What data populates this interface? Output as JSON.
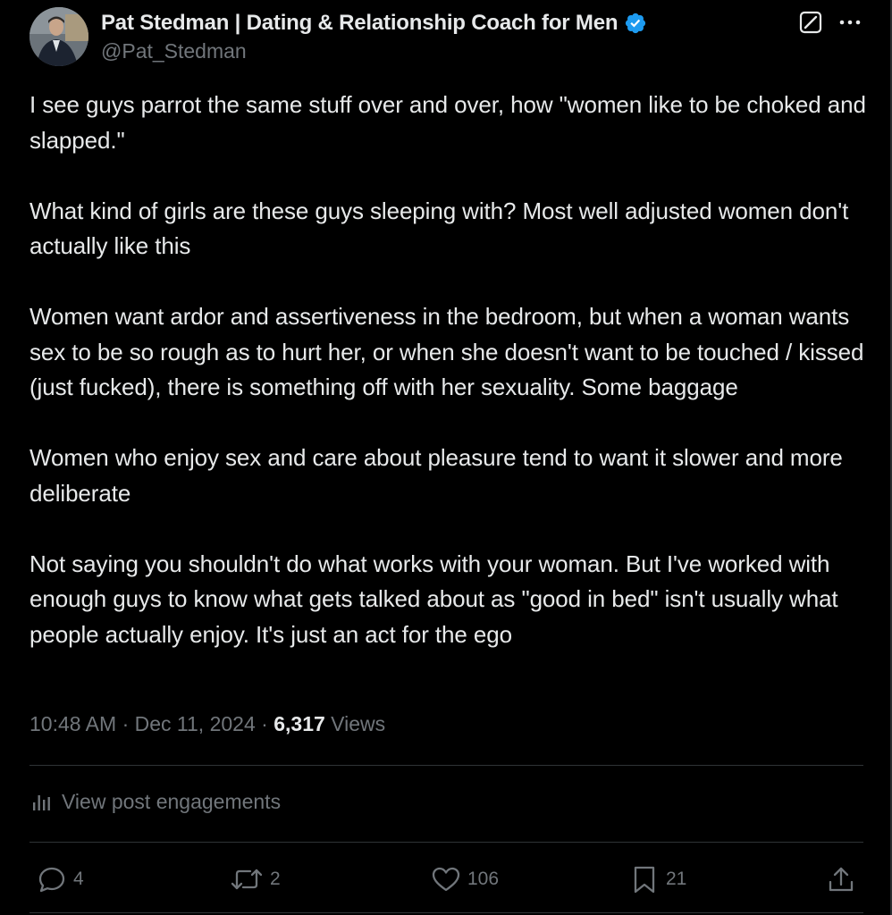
{
  "author": {
    "display_name": "Pat Stedman | Dating & Relationship Coach for Men",
    "handle": "@Pat_Stedman",
    "verified": true,
    "verified_color": "#1d9bf0"
  },
  "tweet": {
    "paragraphs": [
      "I see guys parrot the same stuff over and over, how \"women like to be choked and slapped.\"",
      "What kind of girls are these guys sleeping with? Most well adjusted women don't actually like this",
      "Women want ardor and assertiveness in the bedroom, but when a woman wants sex to be so rough as to hurt her, or when she doesn't want to be touched / kissed (just fucked), there is something off with her sexuality. Some baggage",
      "Women who enjoy sex and care about pleasure tend to want it slower and more deliberate",
      "Not saying you shouldn't do what works with your woman. But I've worked with enough guys to know what gets talked about as \"good in bed\" isn't usually what people actually enjoy. It's just an act for the ego"
    ]
  },
  "meta": {
    "time": "10:48 AM",
    "separator": "·",
    "date": "Dec 11, 2024",
    "views_count": "6,317",
    "views_label": "Views"
  },
  "engagements": {
    "label": "View post engagements",
    "icon": "analytics-icon"
  },
  "actions": {
    "replies": "4",
    "reposts": "2",
    "likes": "106",
    "bookmarks": "21"
  },
  "icons": {
    "grok": "grok-icon",
    "more": "more-icon",
    "reply": "reply-icon",
    "repost": "repost-icon",
    "like": "like-icon",
    "bookmark": "bookmark-icon",
    "share": "share-icon"
  },
  "colors": {
    "background": "#000000",
    "text_primary": "#e7e9ea",
    "text_secondary": "#71767b",
    "divider": "#2f3336"
  }
}
